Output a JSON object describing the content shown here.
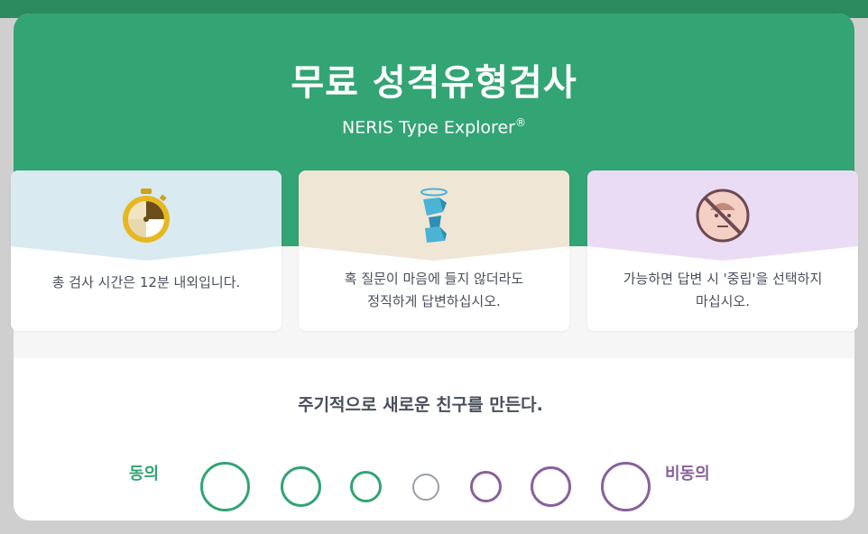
{
  "header": {
    "title": "무료 성격유형검사",
    "subtitle": "NERIS Type Explorer",
    "subtitle_mark": "®"
  },
  "tips": [
    {
      "icon": "stopwatch-icon",
      "color": "#d9eaf0",
      "text": "총 검사 시간은 12분 내외입니다."
    },
    {
      "icon": "statue-angel-icon",
      "color": "#efe6d6",
      "text_line1": "혹 질문이 마음에 들지 않더라도",
      "text_line2": "정직하게 답변하십시오."
    },
    {
      "icon": "no-neutral-face-icon",
      "color": "#eadcf5",
      "text_line1": "가능하면 답변 시 '중립'을 선택하지",
      "text_line2": "마십시오."
    }
  ],
  "question": {
    "text": "주기적으로 새로운 친구를 만든다.",
    "agree_label": "동의",
    "disagree_label": "비동의",
    "options": [
      "strongly-agree",
      "agree",
      "slightly-agree",
      "neutral",
      "slightly-disagree",
      "disagree",
      "strongly-disagree"
    ]
  },
  "colors": {
    "brand_green": "#33a474",
    "disagree_purple": "#88619a",
    "neutral_gray": "#9aa0a6",
    "text_dark": "#4a4f5c"
  }
}
